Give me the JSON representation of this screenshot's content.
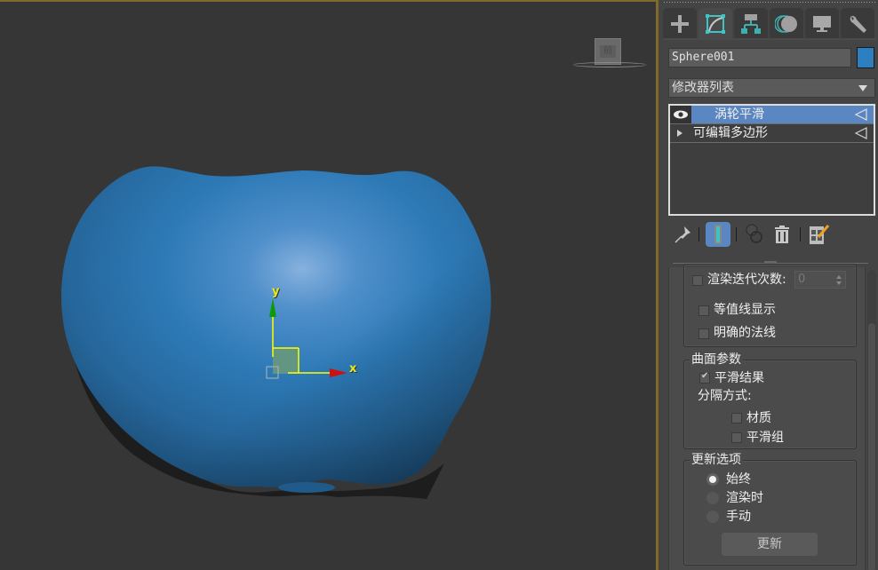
{
  "viewport": {
    "object_color": "#2f7cb8",
    "gizmo": {
      "x_label": "x",
      "y_label": "y"
    },
    "viewcube_face": "前"
  },
  "command_panel": {
    "tabs": [
      {
        "name": "create",
        "icon": "plus-icon"
      },
      {
        "name": "modify",
        "icon": "modify-curve-icon",
        "active": true
      },
      {
        "name": "hierarchy",
        "icon": "hierarchy-icon"
      },
      {
        "name": "motion",
        "icon": "motion-icon"
      },
      {
        "name": "display",
        "icon": "monitor-icon"
      },
      {
        "name": "utilities",
        "icon": "wrench-icon"
      }
    ],
    "object_name": "Sphere001",
    "object_color": "#2e7fc0",
    "modifier_list_label": "修改器列表",
    "stack": [
      {
        "label": "涡轮平滑",
        "selected": true
      },
      {
        "label": "可编辑多边形",
        "selected": false
      }
    ],
    "stack_tools": [
      "pin-stack-icon",
      "show-end-result-icon",
      "make-unique-icon",
      "remove-modifier-icon",
      "configure-sets-icon"
    ],
    "rollouts": {
      "render_iters_label": "渲染迭代次数:",
      "render_iters_value": "0",
      "isoline_display_label": "等值线显示",
      "explicit_normals_label": "明确的法线",
      "surface_params_title": "曲面参数",
      "smooth_result_label": "平滑结果",
      "separate_by_label": "分隔方式:",
      "materials_label": "材质",
      "smoothing_groups_label": "平滑组",
      "update_options_title": "更新选项",
      "update_options": [
        {
          "label": "始终",
          "selected": true
        },
        {
          "label": "渲染时",
          "selected": false
        },
        {
          "label": "手动",
          "selected": false
        }
      ],
      "update_button_label": "更新"
    }
  }
}
